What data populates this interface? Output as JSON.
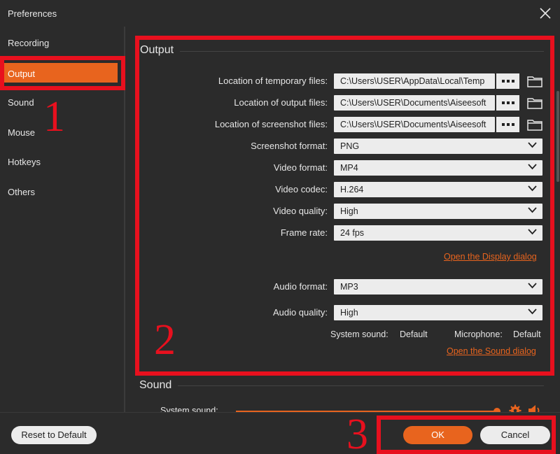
{
  "window": {
    "title": "Preferences"
  },
  "sidebar": {
    "items": [
      {
        "label": "Recording"
      },
      {
        "label": "Output"
      },
      {
        "label": "Sound"
      },
      {
        "label": "Mouse"
      },
      {
        "label": "Hotkeys"
      },
      {
        "label": "Others"
      }
    ]
  },
  "output": {
    "section_title": "Output",
    "temp_files": {
      "label": "Location of temporary files:",
      "value": "C:\\Users\\USER\\AppData\\Local\\Temp"
    },
    "output_files": {
      "label": "Location of output files:",
      "value": "C:\\Users\\USER\\Documents\\Aiseesoft"
    },
    "screenshot_files": {
      "label": "Location of screenshot files:",
      "value": "C:\\Users\\USER\\Documents\\Aiseesoft"
    },
    "screenshot_format": {
      "label": "Screenshot format:",
      "value": "PNG"
    },
    "video_format": {
      "label": "Video format:",
      "value": "MP4"
    },
    "video_codec": {
      "label": "Video codec:",
      "value": "H.264"
    },
    "video_quality": {
      "label": "Video quality:",
      "value": "High"
    },
    "frame_rate": {
      "label": "Frame rate:",
      "value": "24 fps"
    },
    "display_dialog_link": "Open the Display dialog",
    "audio_format": {
      "label": "Audio format:",
      "value": "MP3"
    },
    "audio_quality": {
      "label": "Audio quality:",
      "value": "High"
    },
    "system_sound": {
      "label": "System sound:",
      "value": "Default"
    },
    "microphone": {
      "label": "Microphone:",
      "value": "Default"
    },
    "sound_dialog_link": "Open the Sound dialog"
  },
  "sound": {
    "section_title": "Sound",
    "system_sound_label": "System sound:",
    "system_sound_level": 0.98
  },
  "footer": {
    "reset_label": "Reset to Default",
    "ok_label": "OK",
    "cancel_label": "Cancel"
  },
  "annotations": {
    "n1": "1",
    "n2": "2",
    "n3": "3"
  },
  "colors": {
    "accent": "#e8641e",
    "annotation": "#e8101e",
    "background": "#2b2b2b",
    "field": "#ececec"
  }
}
